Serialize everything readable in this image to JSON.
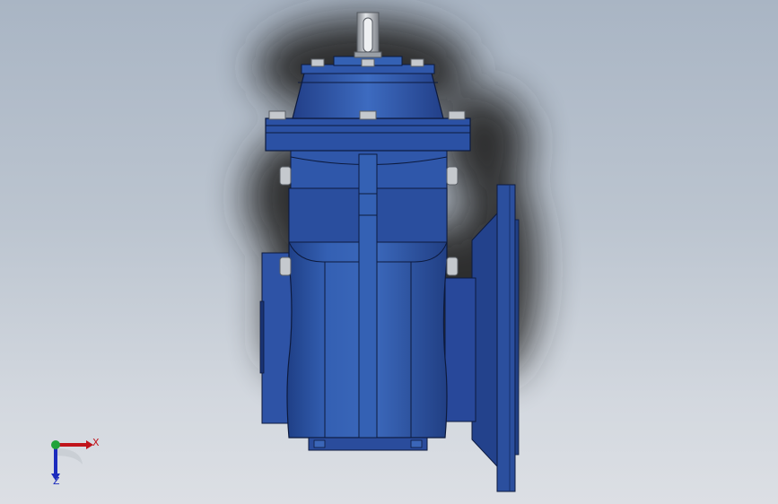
{
  "viewport": {
    "background_top": "#a9b5c4",
    "background_bottom": "#dcdfe4"
  },
  "model": {
    "body_color": "#2f56a6",
    "shadow_color": "#2a2a2a",
    "shaft_color": "#b7bcc2",
    "bolt_color": "#c9cdd2"
  },
  "triad": {
    "x_label": "X",
    "z_label": "Z",
    "x_color": "#c0141b",
    "y_color": "#1fa33a",
    "z_color": "#1b2bbd",
    "icons": [
      "axis-x-arrow-icon",
      "axis-y-dot-icon",
      "axis-z-arrow-icon"
    ]
  }
}
